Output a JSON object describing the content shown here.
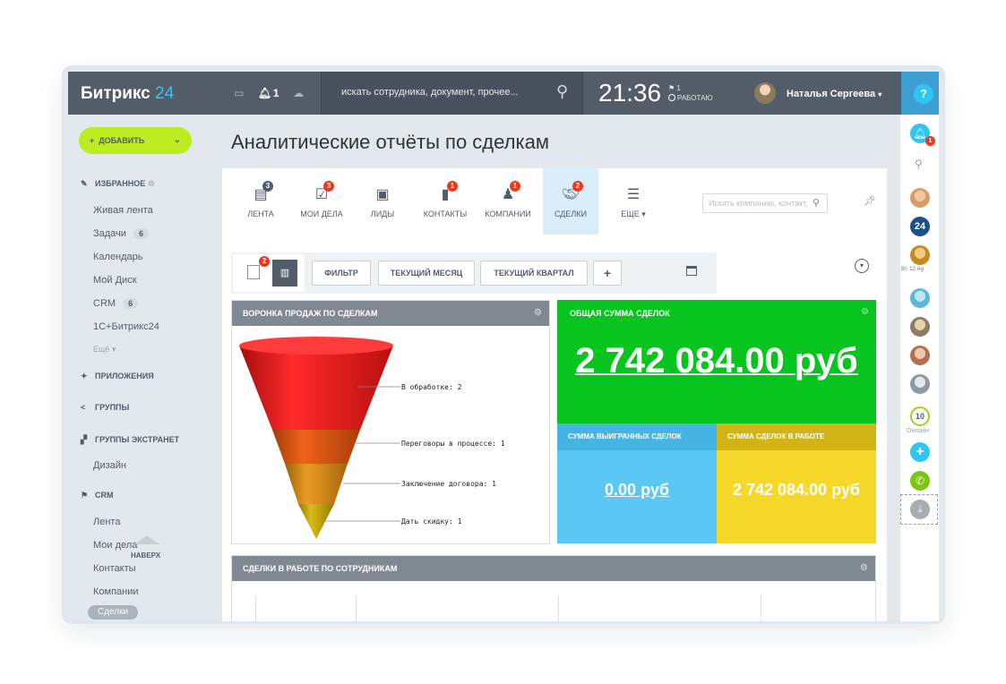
{
  "header": {
    "logo_text": "Битрикс",
    "logo_num": "24",
    "notif_count": "1",
    "search_placeholder": "искать сотрудника, документ, прочее...",
    "time": "21:36",
    "flag_count": "1",
    "work_status": "РАБОТАЮ",
    "user_name": "Наталья Сергеева",
    "help_label": "?"
  },
  "sidebar": {
    "add_label": "ДОБАВИТЬ",
    "favorites": "ИЗБРАННОЕ",
    "items_fav": [
      {
        "label": "Живая лента"
      },
      {
        "label": "Задачи",
        "count": "6"
      },
      {
        "label": "Календарь"
      },
      {
        "label": "Мой Диск"
      },
      {
        "label": "CRM",
        "count": "6"
      },
      {
        "label": "1С+Битрикс24"
      }
    ],
    "more": "Ещё",
    "apps": "ПРИЛОЖЕНИЯ",
    "groups": "ГРУППЫ",
    "groups_extranet": "ГРУППЫ ЭКСТРАНЕТ",
    "extranet_item": "Дизайн",
    "crm": "CRM",
    "crm_items": [
      "Лента",
      "Мои дела",
      "Контакты",
      "Компании"
    ],
    "up_label": "НАВЕРХ",
    "deals_pill": "Сделки"
  },
  "page_title": "Аналитические отчёты по сделкам",
  "crm_tabs": [
    {
      "label": "ЛЕНТА",
      "badge": "3",
      "icon": "feed-icon"
    },
    {
      "label": "МОИ ДЕЛА",
      "badge": "3",
      "icon": "tasks-icon"
    },
    {
      "label": "ЛИДЫ",
      "badge": "",
      "icon": "leads-icon"
    },
    {
      "label": "КОНТАКТЫ",
      "badge": "1",
      "icon": "contacts-icon"
    },
    {
      "label": "КОМПАНИИ",
      "badge": "1",
      "icon": "companies-icon"
    },
    {
      "label": "СДЕЛКИ",
      "badge": "2",
      "icon": "deals-icon"
    },
    {
      "label": "ЕЩЕ",
      "badge": "",
      "icon": "more-icon"
    }
  ],
  "crm_search_placeholder": "Искать компанию, контакт,",
  "filter": {
    "toggle_badge": "2",
    "filter_btn": "ФИЛЬТР",
    "month_btn": "ТЕКУЩИЙ МЕСЯЦ",
    "quarter_btn": "ТЕКУЩИЙ КВАРТАЛ",
    "add_btn": "+"
  },
  "funnel": {
    "title": "ВОРОНКА ПРОДАЖ ПО СДЕЛКАМ",
    "stages": [
      {
        "label": "В обработке: 2",
        "color": "#e81717"
      },
      {
        "label": "Переговоры в процессе: 1",
        "color": "#e2540d"
      },
      {
        "label": "Заключение договора: 1",
        "color": "#dc8a13"
      },
      {
        "label": "Дать скидку: 1",
        "color": "#c9a70c"
      }
    ]
  },
  "total": {
    "title": "ОБЩАЯ СУММА СДЕЛОК",
    "value": "2 742 084.00 руб"
  },
  "won": {
    "title": "СУММА ВЫИГРАННЫХ СДЕЛОК",
    "value": "0.00 руб"
  },
  "inwork": {
    "title": "СУММА СДЕЛОК В РАБОТЕ",
    "value": "2 742 084.00 руб"
  },
  "employees_widget": {
    "title": "СДЕЛКИ В РАБОТЕ ПО СОТРУДНИКАМ"
  },
  "rightbar": {
    "date_label": "Вт, 12 Ag",
    "online_count": "10",
    "online_label": "Онлайн",
    "notif_badge": "1",
    "b24": "24"
  }
}
